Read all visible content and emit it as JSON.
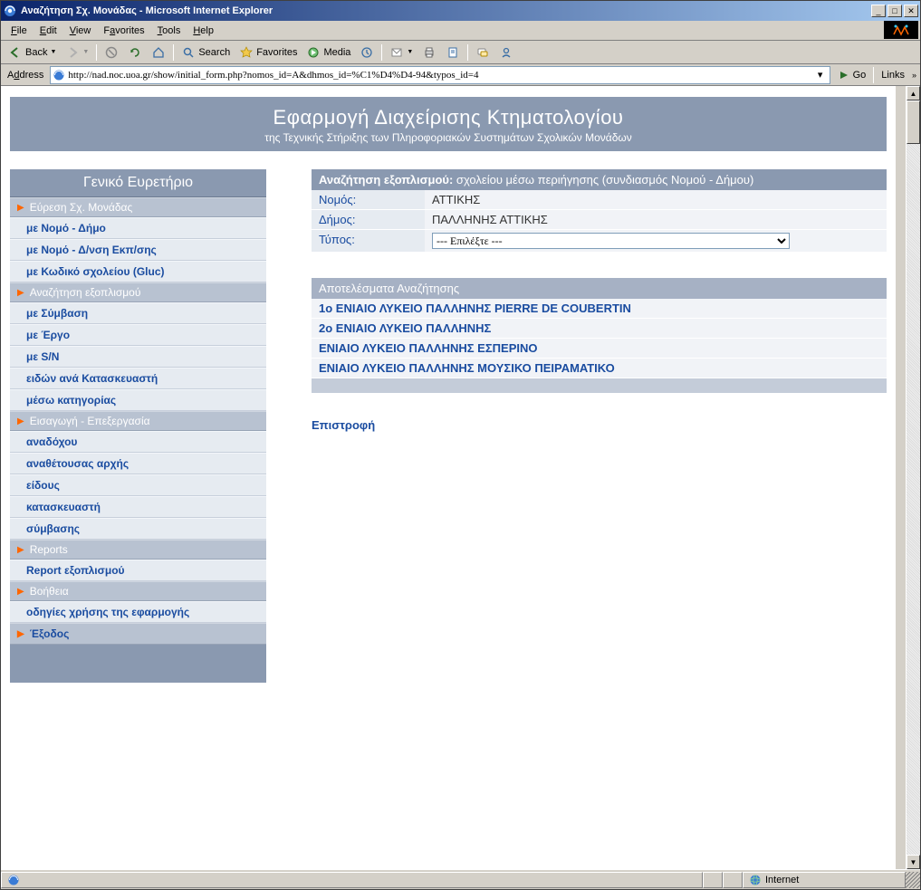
{
  "window": {
    "title": "Αναζήτηση Σχ. Μονάδας - Microsoft Internet Explorer"
  },
  "menubar": {
    "file": "File",
    "edit": "Edit",
    "view": "View",
    "favorites": "Favorites",
    "tools": "Tools",
    "help": "Help"
  },
  "toolbar": {
    "back": "Back",
    "search": "Search",
    "favorites": "Favorites",
    "media": "Media"
  },
  "addressbar": {
    "label": "Address",
    "url": "http://nad.noc.uoa.gr/show/initial_form.php?nomos_id=A&dhmos_id=%C1%D4%D4-94&typos_id=4",
    "go": "Go",
    "links": "Links"
  },
  "header": {
    "title": "Εφαρμογή Διαχείρισης Κτηματολογίου",
    "subtitle": "της Τεχνικής Στήριξης των Πληροφοριακών Συστημάτων Σχολικών Μονάδων"
  },
  "sidebar": {
    "title": "Γενικό Ευρετήριο",
    "sect_find": "Εύρεση Σχ. Μονάδας",
    "links_find": [
      "με Νομό - Δήμο",
      "με Νομό - Δ/νση Εκπ/σης",
      "με Κωδικό σχολείου (Gluc)"
    ],
    "sect_search": "Αναζήτηση εξοπλισμού",
    "links_search": [
      "με Σύμβαση",
      "με Έργο",
      "με S/N",
      "ειδών ανά Κατασκευαστή",
      "μέσω κατηγορίας"
    ],
    "sect_edit": "Εισαγωγή - Επεξεργασία",
    "links_edit": [
      "αναδόχου",
      "αναθέτουσας αρχής",
      "είδους",
      "κατασκευαστή",
      "σύμβασης"
    ],
    "sect_reports": "Reports",
    "links_reports": [
      "Report εξοπλισμού"
    ],
    "sect_help": "Βοήθεια",
    "links_help": [
      "οδηγίες χρήσης της εφαρμογής"
    ],
    "exit": "Έξοδος"
  },
  "search": {
    "title_bold": "Αναζήτηση εξοπλισμού:",
    "title_rest": " σχολείου μέσω περιήγησης (συνδιασμός Νομού - Δήμου)",
    "label_nomos": "Νομός:",
    "value_nomos": "ΑΤΤΙΚΗΣ",
    "label_dimos": "Δήμος:",
    "value_dimos": "ΠΑΛΛΗΝΗΣ ΑΤΤΙΚΗΣ",
    "label_typos": "Τύπος:",
    "select_placeholder": "--- Επιλέξτε ---"
  },
  "results": {
    "header": "Αποτελέσματα Αναζήτησης",
    "items": [
      "1ο ΕΝΙΑΙΟ ΛΥΚΕΙΟ ΠΑΛΛΗΝΗΣ PIERRE DE COUBERTIN",
      "2ο ΕΝΙΑΙΟ ΛΥΚΕΙΟ ΠΑΛΛΗΝΗΣ",
      "ΕΝΙΑΙΟ ΛΥΚΕΙΟ ΠΑΛΛΗΝΗΣ ΕΣΠΕΡΙΝΟ",
      "ΕΝΙΑΙΟ ΛΥΚΕΙΟ ΠΑΛΛΗΝΗΣ ΜΟΥΣΙΚΟ ΠΕΙΡΑΜΑΤΙΚΟ"
    ],
    "back": "Επιστροφή"
  },
  "statusbar": {
    "zone": "Internet"
  }
}
